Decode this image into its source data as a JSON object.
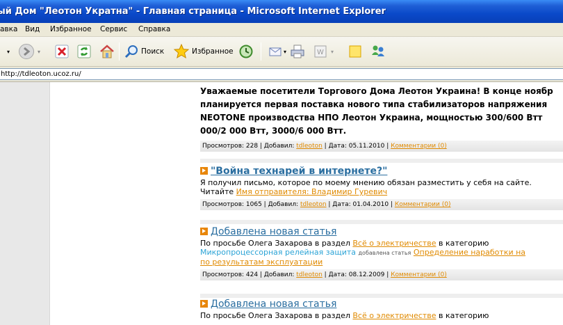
{
  "window": {
    "title": "ый Дом \"Леотон Укратна\" - Главная страница - Microsoft Internet Explorer"
  },
  "menu": [
    "авка",
    "Вид",
    "Избранное",
    "Сервис",
    "Справка"
  ],
  "toolbar": {
    "search_label": "Поиск",
    "favorites_label": "Избранное"
  },
  "address": {
    "url": "http://tdleoton.ucoz.ru/"
  },
  "posts": [
    {
      "body_lines": [
        "Уважаемые посетители Торгового Дома Леотон Украина! В конце ноябр",
        "планируется первая поставка нового типа стабилизаторов напряжения",
        "NEOTONE производства НПО Леотон Украина, мощностью 300/600 Втт",
        "000/2 000 Втт, 3000/6 000 Втт."
      ],
      "meta": {
        "views_label": "Просмотров:",
        "views": "228",
        "added_label": "Добавил:",
        "author": "tdleoton",
        "date_label": "Дата:",
        "date": "05.11.2010",
        "comments": "Комментарии (0)"
      }
    },
    {
      "title": "\"Война технарей в интернете?\"",
      "body_line1": "Я получил письмо, которое по моему мнению обязан разместить у себя на сайте.",
      "body_line2_prefix": "Читайте",
      "body_line2_link": "Имя отправителя: Владимир Гуревич",
      "meta": {
        "views_label": "Просмотров:",
        "views": "1065",
        "added_label": "Добавил:",
        "author": "tdleoton",
        "date_label": "Дата:",
        "date": "01.04.2010",
        "comments": "Комментарии (0)"
      }
    },
    {
      "title": "Добавлена новая статья",
      "line1_prefix": "По просьбе Олега Захарова в раздел",
      "line1_link": "Всё о электричестве",
      "line1_suffix": "в категорию",
      "line2_blue": "Микропроцессорная релейная защита",
      "line2_small": "добавлена статья",
      "line2_link": "Определение наработки на",
      "line3_link": "по результатам эксплуатации",
      "meta": {
        "views_label": "Просмотров:",
        "views": "424",
        "added_label": "Добавил:",
        "author": "tdleoton",
        "date_label": "Дата:",
        "date": "08.12.2009",
        "comments": "Комментарии (0)"
      }
    },
    {
      "title": "Добавлена новая статья",
      "line1_prefix": "По просьбе Олега Захарова в раздел",
      "line1_link": "Всё о электричестве",
      "line1_suffix": "в категорию"
    }
  ]
}
